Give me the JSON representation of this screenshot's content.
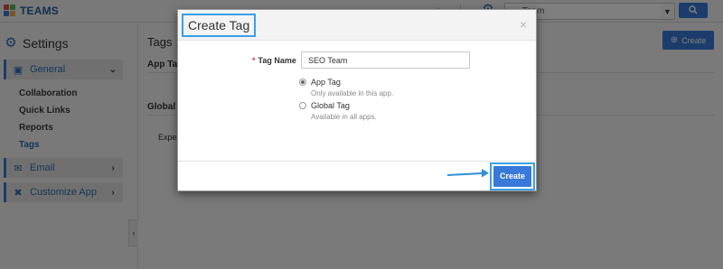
{
  "app": {
    "name": "TEAMS"
  },
  "topbar": {
    "team_select_value": "... Team",
    "search_icon": "search-icon"
  },
  "sidebar": {
    "title": "Settings",
    "sections": [
      {
        "label": "General",
        "icon": "desktop-icon"
      },
      {
        "label": "Email",
        "icon": "envelope-icon"
      },
      {
        "label": "Customize App",
        "icon": "tools-icon"
      }
    ],
    "sub_items": [
      "Collaboration",
      "Quick Links",
      "Reports",
      "Tags"
    ],
    "active_sub_item": "Tags"
  },
  "main": {
    "title": "Tags",
    "app_tag_heading": "App Tag",
    "global_tag_heading": "Global T",
    "exp_text": "Expe",
    "create_button": "Create"
  },
  "modal": {
    "title": "Create Tag",
    "close_symbol": "×",
    "tag_name_label": "Tag Name",
    "required_marker": "*",
    "tag_name_value": "SEO Team",
    "options": [
      {
        "label": "App Tag",
        "help": "Only available in this app.",
        "checked": true
      },
      {
        "label": "Global Tag",
        "help": "Available in all apps.",
        "checked": false
      }
    ],
    "create_button": "Create"
  },
  "colors": {
    "accent": "#3879d9",
    "highlight": "#3ba0e6"
  }
}
